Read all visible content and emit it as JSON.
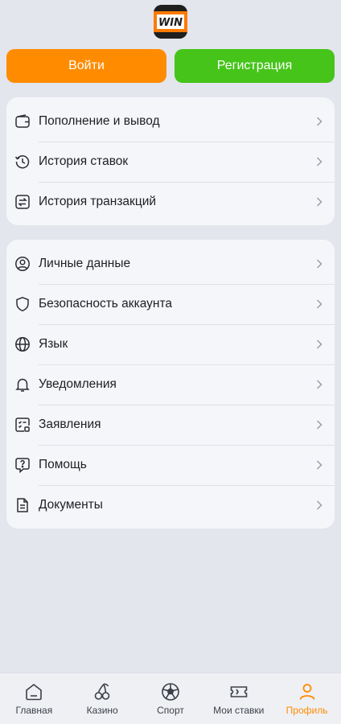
{
  "app": {
    "logo_text": "WIN",
    "accent": "#ff8c00",
    "success": "#46c41a"
  },
  "auth": {
    "login_label": "Войти",
    "register_label": "Регистрация"
  },
  "menu_primary": [
    {
      "label": "Пополнение и вывод",
      "icon": "wallet-icon"
    },
    {
      "label": "История ставок",
      "icon": "history-icon"
    },
    {
      "label": "История транзакций",
      "icon": "transactions-icon"
    }
  ],
  "menu_secondary": [
    {
      "label": "Личные данные",
      "icon": "user-icon"
    },
    {
      "label": "Безопасность аккаунта",
      "icon": "shield-icon"
    },
    {
      "label": "Язык",
      "icon": "globe-icon"
    },
    {
      "label": "Уведомления",
      "icon": "bell-icon"
    },
    {
      "label": "Заявления",
      "icon": "applications-icon"
    },
    {
      "label": "Помощь",
      "icon": "help-icon"
    },
    {
      "label": "Документы",
      "icon": "document-icon"
    }
  ],
  "bottom_nav": [
    {
      "label": "Главная",
      "icon": "home-icon",
      "active": false
    },
    {
      "label": "Казино",
      "icon": "cherries-icon",
      "active": false
    },
    {
      "label": "Спорт",
      "icon": "soccer-ball-icon",
      "active": false
    },
    {
      "label": "Мои ставки",
      "icon": "ticket-icon",
      "active": false
    },
    {
      "label": "Профиль",
      "icon": "profile-icon",
      "active": true
    }
  ]
}
